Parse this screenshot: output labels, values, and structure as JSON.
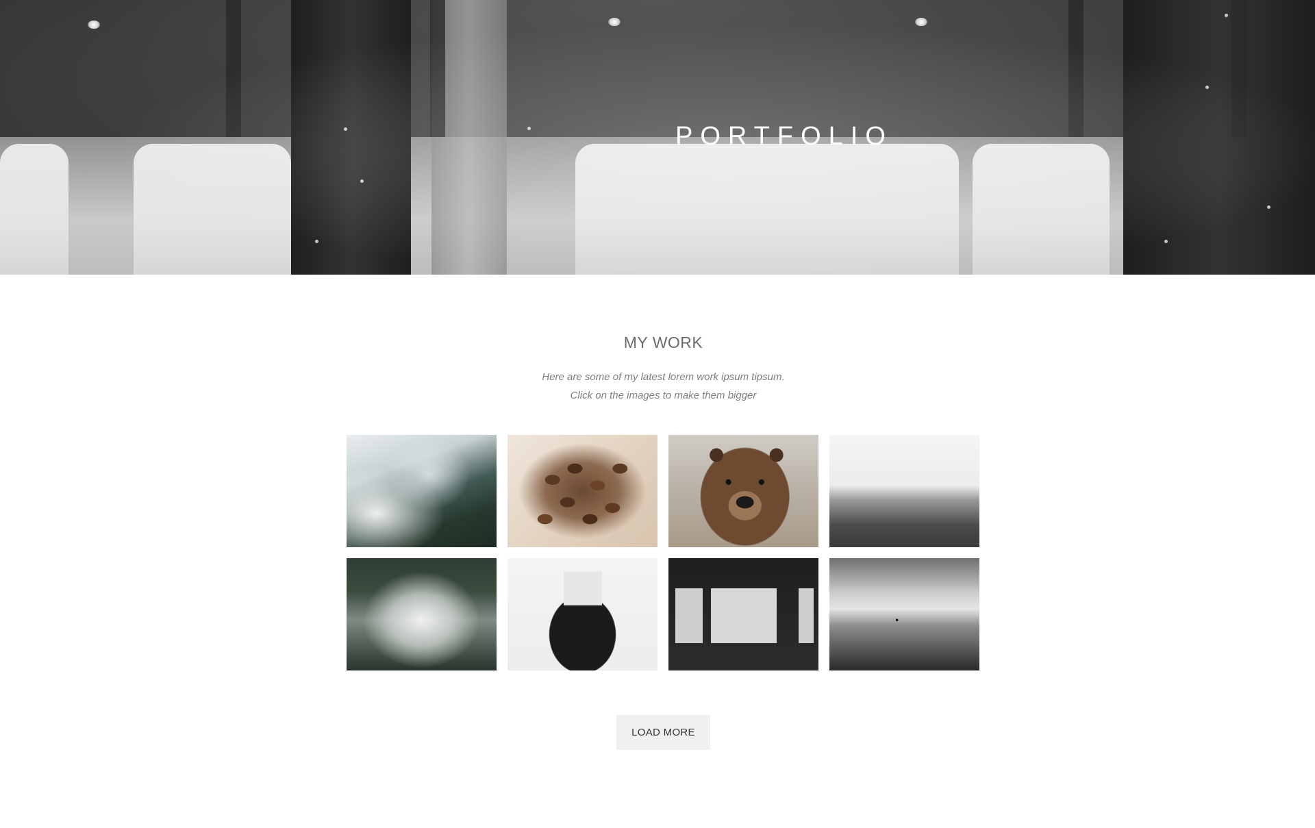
{
  "hero": {
    "title": "PORTFOLIO"
  },
  "work": {
    "heading": "MY WORK",
    "subtitle_line1": "Here are some of my latest lorem work ipsum tipsum.",
    "subtitle_line2": "Click on the images to make them bigger"
  },
  "gallery": {
    "items": [
      {
        "subject": "misty mountain"
      },
      {
        "subject": "coffee beans"
      },
      {
        "subject": "brown bear"
      },
      {
        "subject": "foggy sea"
      },
      {
        "subject": "foggy forest"
      },
      {
        "subject": "typewriter"
      },
      {
        "subject": "train interior"
      },
      {
        "subject": "sea with boat"
      }
    ]
  },
  "actions": {
    "load_more_label": "LOAD MORE"
  }
}
